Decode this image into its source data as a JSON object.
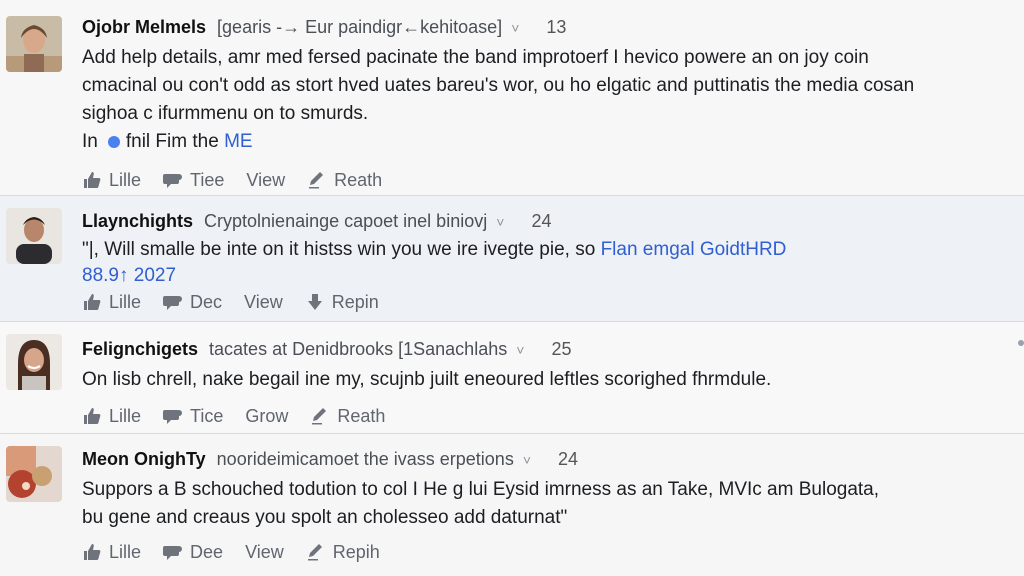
{
  "posts": [
    {
      "author": "Ojobr Melmels",
      "meta": "[gearis -→ Eur paindigr←kehitoase]",
      "chevron": "˅",
      "count": "13",
      "lines": [
        "Add help details, amr med fersed pacinate the band improtoerf I hevico powere an on joy coin",
        "cmacinal ou con't odd as stort hved uates bareu's wor, ou ho elgatic and puttinatis the media cosan",
        "sighoa c ifurmmenu on to smurds."
      ],
      "line4_prefix": "In",
      "line4_rest": "fnil Fim the",
      "line4_link": "ME",
      "actions": [
        "Lille",
        "Tiee",
        "View",
        "Reath"
      ]
    },
    {
      "author": "Llaynchights",
      "meta": "Cryptolnienainge capoet inel biniovj",
      "chevron": "˅",
      "count": "24",
      "line1": "\"|, Will smalle be inte on it histss win you we ire ivegte pie, so",
      "line1_link": "Flan emgal GoidtHRD",
      "line2_link": "88.9↑ 2027",
      "actions": [
        "Lille",
        "Dec",
        "View",
        "Repin"
      ]
    },
    {
      "author": "Felignchigets",
      "meta": "tacates at Denidbrooks [1Sanachlahs",
      "chevron": "˅",
      "count": "25",
      "lines": [
        "On lisb chrell, nake begail ine my, scujnb juilt eneoured leftles scorighed fhrmdule."
      ],
      "actions": [
        "Lille",
        "Tice",
        "Grow",
        "Reath"
      ]
    },
    {
      "author": "Meon OnighTy",
      "meta": "noorideimicamoet the ivass erpetions",
      "chevron": "˅",
      "count": "24",
      "lines": [
        "Suppors a B schouched todution to col I He g lui Eysid imrness as an Take, MVIc am Bulogata,",
        "bu gene and creaus you spolt an cholesseo add daturnat\""
      ],
      "actions": [
        "Lille",
        "Dee",
        "View",
        "Repih"
      ]
    }
  ],
  "icons": {
    "like": "thumbs-up-icon",
    "react": "speech-bubble-icon",
    "share": "pencil-icon"
  }
}
